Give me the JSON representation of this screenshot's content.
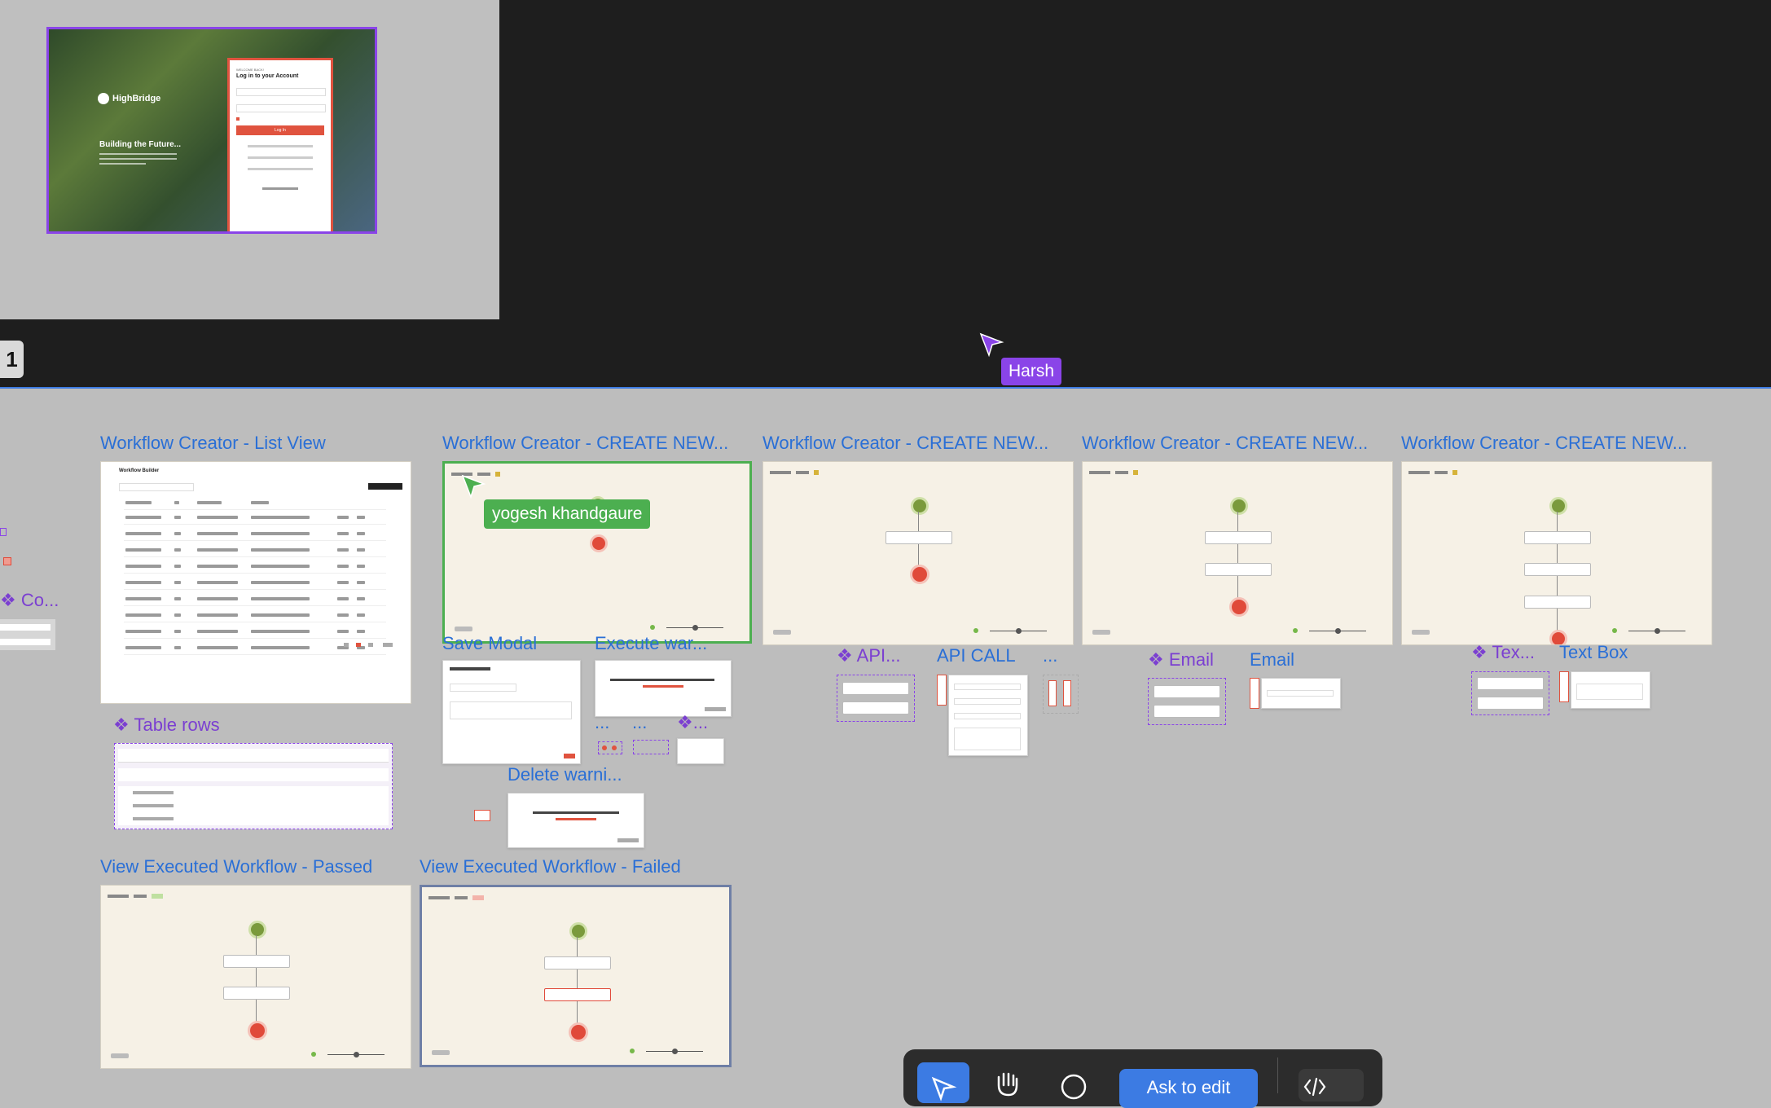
{
  "canvas": {
    "page_number": "1",
    "colors": {
      "canvas_dark": "#1e1e1e",
      "canvas_gray": "#bdbdbd",
      "accent": "#3c7be3",
      "component": "#7b3fd1",
      "selection_green": "#4caf50"
    }
  },
  "login_thumb": {
    "brand": "HighBridge",
    "tagline": "Building the Future...",
    "welcome": "WELCOME BACK!",
    "heading": "Log in to your Account",
    "login_button": "Log In"
  },
  "collaborators": {
    "harsh": {
      "name": "Harsh",
      "color": "#8a44e8"
    },
    "yogesh": {
      "name": "yogesh khandgaure",
      "color": "#4caf50"
    }
  },
  "frames": {
    "list_view": "Workflow Creator - List View",
    "create1": "Workflow Creator - CREATE NEW...",
    "create2": "Workflow Creator - CREATE NEW...",
    "create3": "Workflow Creator - CREATE NEW...",
    "create4": "Workflow Creator - CREATE NEW...",
    "passed": "View Executed Workflow - Passed",
    "failed": "View Executed Workflow - Failed",
    "save_modal": "Save    Modal",
    "execute_warn": "Execute war...",
    "delete_warn": "Delete warni...",
    "api_call": "API CALL",
    "email": "Email",
    "text_box": "Text Box",
    "ellipsis1": "...",
    "ellipsis2": "...",
    "ellipsis3": "...",
    "ellipsis4": "..."
  },
  "components": {
    "left_partial": "Co...",
    "table_rows": "Table rows",
    "api": "API...",
    "email": "Email",
    "text": "Tex...",
    "dots": "..."
  },
  "list_view_thumb": {
    "title": "Workflow Builder"
  },
  "toolbar": {
    "ask_to_edit": "Ask to edit"
  },
  "icons": {
    "move": "pointer-icon",
    "hand": "hand-icon",
    "comment": "comment-icon",
    "code": "code-icon",
    "component": "component-icon"
  }
}
